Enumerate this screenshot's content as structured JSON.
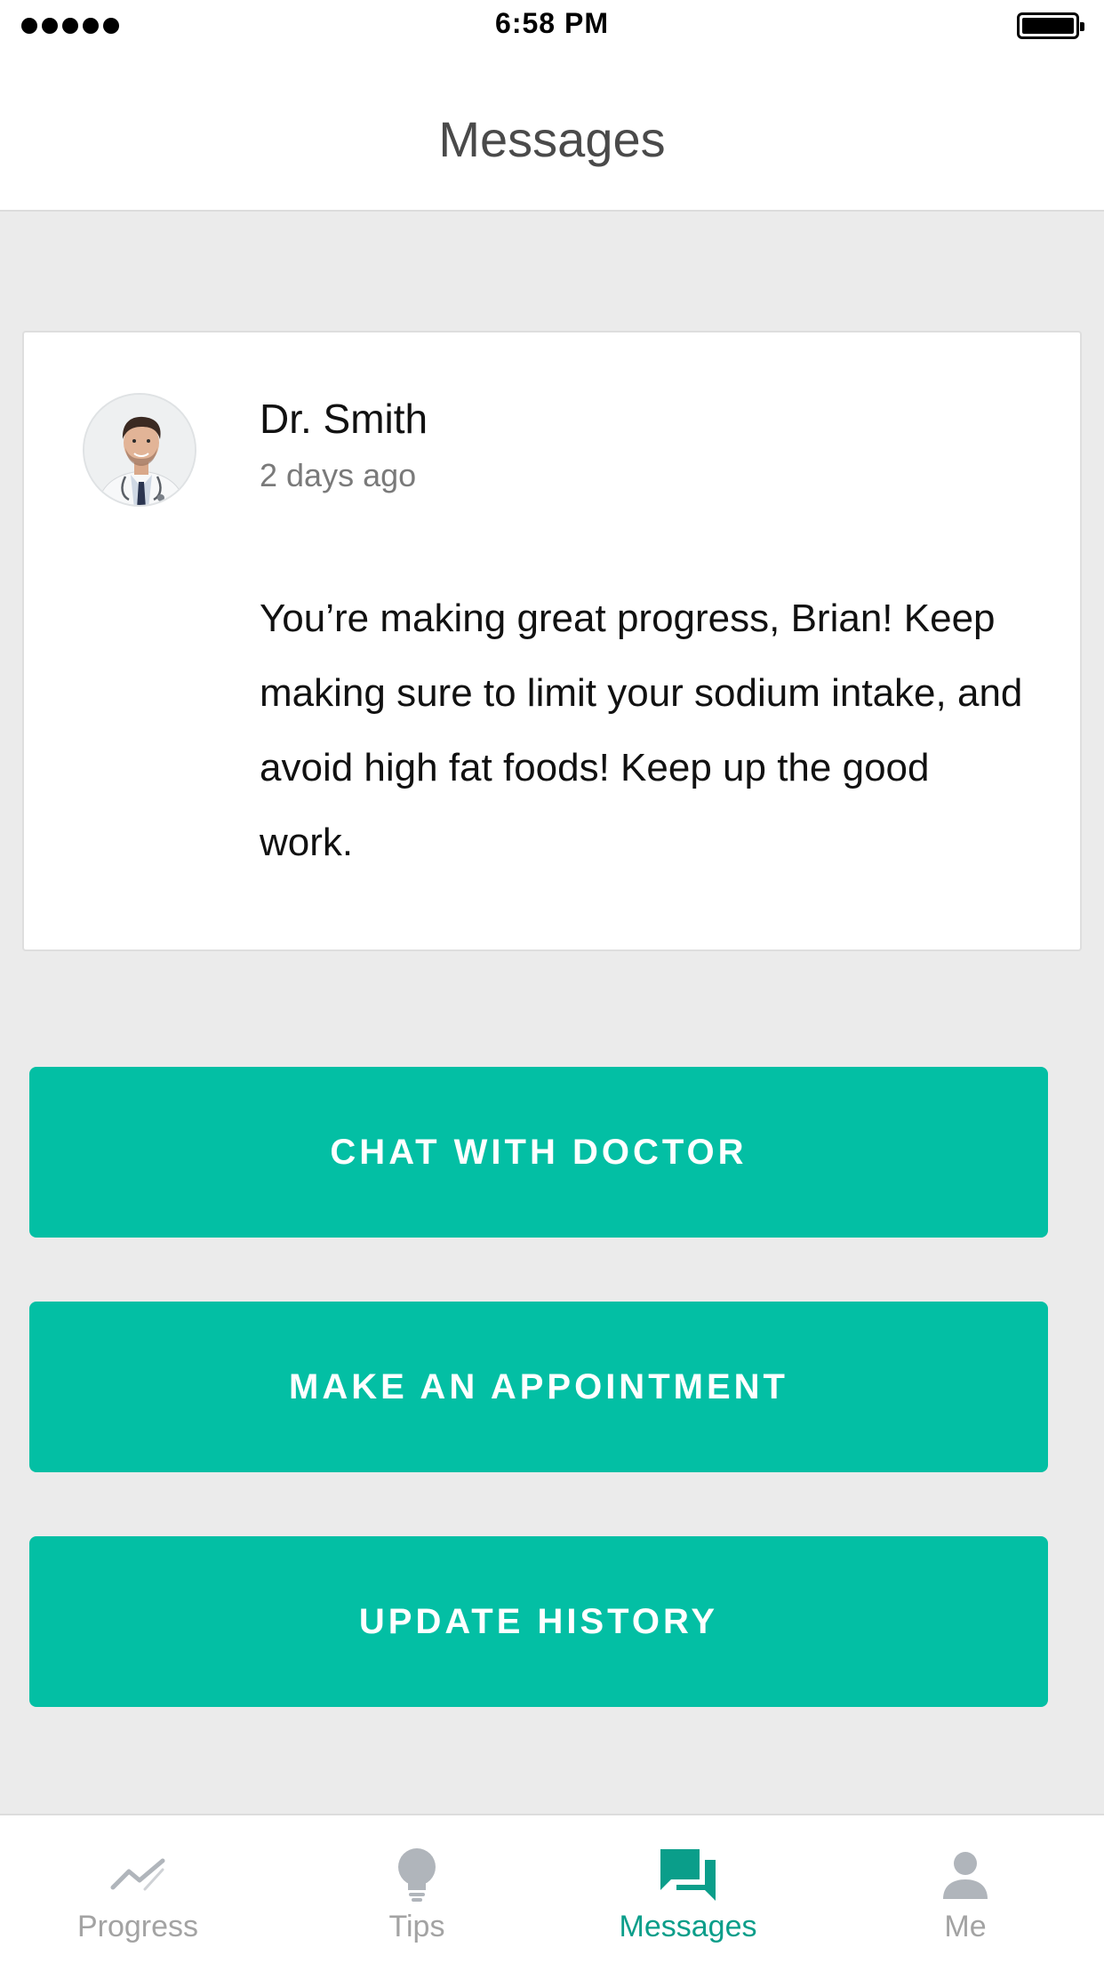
{
  "status_bar": {
    "time": "6:58 PM"
  },
  "header": {
    "title": "Messages"
  },
  "message": {
    "sender": "Dr. Smith",
    "time_ago": "2 days ago",
    "body": "You’re making great progress, Brian! Keep making sure to limit your sodium intake, and avoid high fat foods! Keep up the good work.",
    "avatar_icon": "doctor-avatar"
  },
  "actions": {
    "chat_label": "CHAT WITH DOCTOR",
    "appointment_label": "MAKE AN APPOINTMENT",
    "history_label": "UPDATE HISTORY"
  },
  "tabs": [
    {
      "label": "Progress",
      "icon": "trend-line-icon",
      "active": false
    },
    {
      "label": "Tips",
      "icon": "lightbulb-icon",
      "active": false
    },
    {
      "label": "Messages",
      "icon": "chat-bubbles-icon",
      "active": true
    },
    {
      "label": "Me",
      "icon": "person-icon",
      "active": false
    }
  ],
  "colors": {
    "accent": "#03bfa4",
    "active_tab": "#0a9e8a",
    "inactive_tab": "#a3a3a3",
    "background": "#ebebeb"
  }
}
